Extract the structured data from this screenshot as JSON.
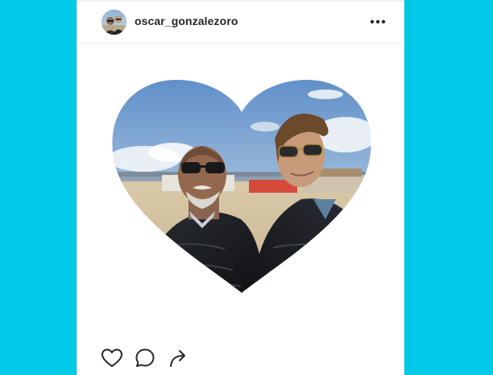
{
  "post": {
    "username": "oscar_gonzalezoro",
    "more_options_icon": "more-horizontal-icon",
    "photo_shape": "heart",
    "actions": {
      "like_icon": "heart-outline-icon",
      "comment_icon": "comment-bubble-icon",
      "share_icon": "share-arrow-icon"
    }
  },
  "colors": {
    "background": "#00c8e8",
    "card": "#ffffff",
    "text": "#262626",
    "divider": "#eceef1"
  }
}
